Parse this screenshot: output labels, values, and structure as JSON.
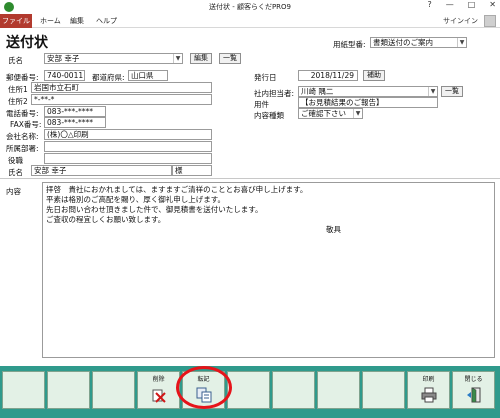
{
  "window": {
    "title": "送付状 - 顧客らくだPRO9",
    "help": "?",
    "minimize": "—",
    "restore": "□",
    "close": "✕"
  },
  "ribbon": {
    "tabs": [
      "ファイル",
      "ホーム",
      "編集",
      "ヘルプ"
    ],
    "signin": "サインイン"
  },
  "form": {
    "title": "送付状",
    "paper_type_label": "用紙型番:",
    "paper_type_value": "書類送付のご案内",
    "name_label": "氏名",
    "name_value": "安部 幸子",
    "edit_button": "編集",
    "list_button": "一覧",
    "postal_label": "郵便番号:",
    "postal_value": "740-0011",
    "prefecture_label": "都道府県:",
    "prefecture_value": "山口県",
    "address1_label": "住所1",
    "address1_value": "岩国市立石町",
    "address2_label": "住所2",
    "address2_value": "*-**-*",
    "phone_label": "電話番号:",
    "phone_value": "083-***-****",
    "fax_label": "FAX番号:",
    "fax_value": "083-***-****",
    "company_label": "会社名称:",
    "company_value": "(株)〇△印刷",
    "department_label": "所属部署:",
    "department_value": "",
    "position_label": "役職",
    "position_value": "",
    "recipient_label": "氏名",
    "recipient_value": "安部 幸子",
    "honorific": "様",
    "issue_date_label": "発行日",
    "issue_date_value": "2018/11/29",
    "assist_button": "補助",
    "staff_label": "社内担当者:",
    "staff_value": "川崎 隅二",
    "staff_list_button": "一覧",
    "subject_label": "用件",
    "subject_value": "【お見積結果のご報告】",
    "content_type_label": "内容種類",
    "content_type_value": "ご確認下さい",
    "content_label": "内容",
    "content_lines": [
      "拝啓　貴社におかれましては、ますますご清祥のこととお喜び申し上げます。",
      "",
      "平素は格別のご高配を賜り、厚く御礼申し上げます。",
      "",
      "先日お問い合わせ頂きました件で、御見積書を送付いたします。",
      "ご査収の程宜しくお願い致します。",
      ""
    ],
    "closing": "敬具"
  },
  "footer": {
    "delete_label": "削除",
    "transcribe_label": "転記",
    "print_label": "印刷",
    "close_label": "閉じる"
  },
  "colors": {
    "footer": "#2f9a8c",
    "file_tab": "#b23a2e",
    "highlight": "#e6141a"
  }
}
